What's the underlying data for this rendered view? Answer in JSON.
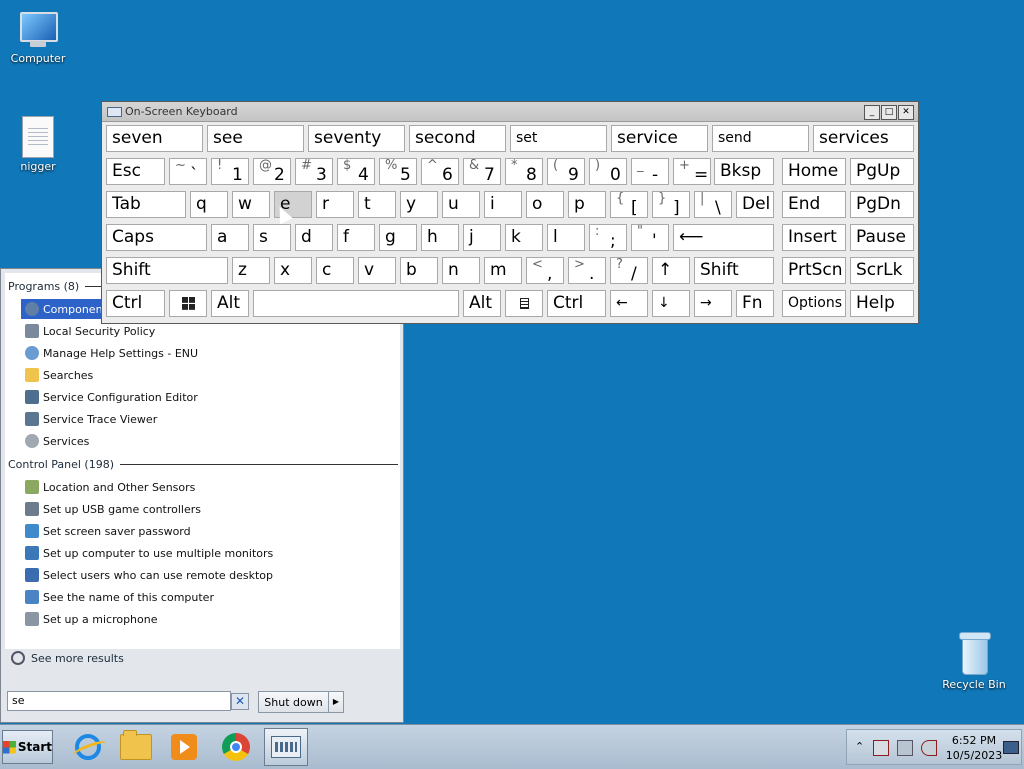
{
  "desktop": {
    "icons": [
      {
        "label": "Computer"
      },
      {
        "label": "nigger"
      },
      {
        "label": "Recycle Bin"
      }
    ]
  },
  "start_menu": {
    "programs_header": "Programs (8)",
    "programs": [
      {
        "label": "Component",
        "icon": "component-services-icon",
        "selected": true
      },
      {
        "label": "Local Security Policy",
        "icon": "security-policy-icon"
      },
      {
        "label": "Manage Help Settings - ENU",
        "icon": "help-settings-icon"
      },
      {
        "label": "Searches",
        "icon": "searches-folder-icon"
      },
      {
        "label": "Service Configuration Editor",
        "icon": "config-editor-icon"
      },
      {
        "label": "Service Trace Viewer",
        "icon": "trace-viewer-icon"
      },
      {
        "label": "Services",
        "icon": "services-gear-icon"
      }
    ],
    "control_panel_header": "Control Panel (198)",
    "control_panel": [
      {
        "label": "Location and Other Sensors",
        "icon": "sensors-icon"
      },
      {
        "label": "Set up USB game controllers",
        "icon": "game-controller-icon"
      },
      {
        "label": "Set screen saver password",
        "icon": "screen-saver-icon"
      },
      {
        "label": "Set up computer to use multiple monitors",
        "icon": "monitors-icon"
      },
      {
        "label": "Select users who can use remote desktop",
        "icon": "remote-desktop-icon"
      },
      {
        "label": "See the name of this computer",
        "icon": "computer-name-icon"
      },
      {
        "label": "Set up a microphone",
        "icon": "microphone-icon"
      }
    ],
    "see_more": "See more results",
    "search_value": "se",
    "shutdown_label": "Shut down"
  },
  "osk": {
    "title": "On-Screen Keyboard",
    "predictions": [
      "seven",
      "see",
      "seventy",
      "second",
      "set",
      "service",
      "send",
      "services"
    ],
    "rows": {
      "numbers": {
        "esc": "Esc",
        "bksp": "Bksp",
        "home": "Home",
        "pgup": "PgUp",
        "keys": [
          [
            "~",
            "`"
          ],
          [
            "!",
            "1"
          ],
          [
            "@",
            "2"
          ],
          [
            "#",
            "3"
          ],
          [
            "$",
            "4"
          ],
          [
            "%",
            "5"
          ],
          [
            "^",
            "6"
          ],
          [
            "&",
            "7"
          ],
          [
            "*",
            "8"
          ],
          [
            "(",
            "9"
          ],
          [
            ")",
            "0"
          ],
          [
            "_",
            "-"
          ],
          [
            "+",
            "="
          ]
        ]
      },
      "top": {
        "tab": "Tab",
        "letters": [
          "q",
          "w",
          "e",
          "r",
          "t",
          "y",
          "u",
          "i",
          "o",
          "p"
        ],
        "brackets": [
          [
            "{",
            "["
          ],
          [
            "}",
            "]"
          ],
          [
            "|",
            "\\"
          ]
        ],
        "del": "Del",
        "end": "End",
        "pgdn": "PgDn"
      },
      "home": {
        "caps": "Caps",
        "letters": [
          "a",
          "s",
          "d",
          "f",
          "g",
          "h",
          "j",
          "k",
          "l"
        ],
        "punct": [
          [
            ":",
            ";"
          ],
          [
            "\"",
            "'"
          ]
        ],
        "enter": "⟵",
        "insert": "Insert",
        "pause": "Pause"
      },
      "bottom": {
        "shift_left": "Shift",
        "letters": [
          "z",
          "x",
          "c",
          "v",
          "b",
          "n",
          "m"
        ],
        "punct": [
          [
            "<",
            ","
          ],
          [
            ">",
            "."
          ],
          [
            "?",
            "/"
          ]
        ],
        "up": "↑",
        "shift_right": "Shift",
        "prtscn": "PrtScn",
        "scrlk": "ScrLk"
      },
      "space": {
        "ctrl_left": "Ctrl",
        "alt_left": "Alt",
        "alt_right": "Alt",
        "ctrl_right": "Ctrl",
        "left": "←",
        "down": "↓",
        "right": "→",
        "fn": "Fn",
        "options": "Options",
        "help": "Help"
      }
    }
  },
  "taskbar": {
    "start_label": "Start",
    "clock_time": "6:52 PM",
    "clock_date": "10/5/2023",
    "tray_expand": "⌃"
  }
}
